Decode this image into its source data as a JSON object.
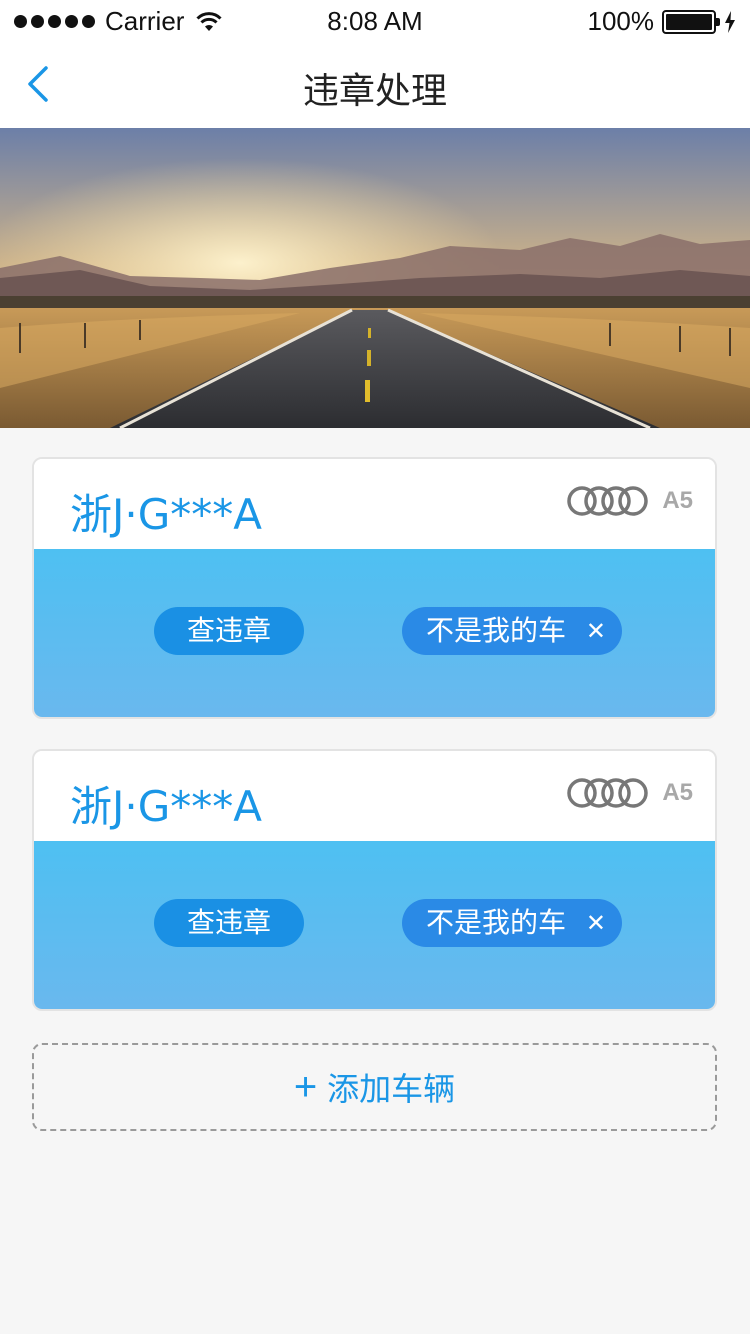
{
  "status_bar": {
    "carrier": "Carrier",
    "time": "8:08 AM",
    "battery": "100%"
  },
  "nav": {
    "title": "违章处理"
  },
  "vehicles": [
    {
      "plate": "浙J·G***A",
      "model": "A5",
      "check_label": "查违章",
      "not_mine_label": "不是我的车",
      "remove_symbol": "✕"
    },
    {
      "plate": "浙J·G***A",
      "model": "A5",
      "check_label": "查违章",
      "not_mine_label": "不是我的车",
      "remove_symbol": "✕"
    }
  ],
  "add_vehicle": {
    "icon": "+",
    "label": "添加车辆"
  },
  "colors": {
    "accent": "#1a96e6",
    "card_body": "#4ec0f2",
    "background": "#f6f6f6"
  }
}
